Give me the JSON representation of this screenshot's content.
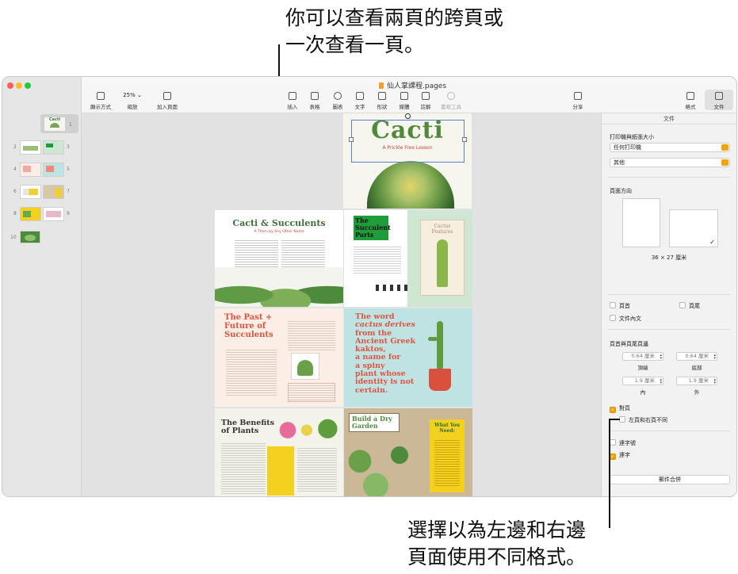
{
  "callouts": {
    "top_line1": "你可以查看兩頁的跨頁或",
    "top_line2": "一次查看一頁。",
    "bottom_line1": "選擇以為左邊和右邊",
    "bottom_line2": "頁面使用不同格式。"
  },
  "window": {
    "title": "仙人掌課程.pages"
  },
  "toolbar": {
    "view": "顯示方式",
    "zoom_value": "25%",
    "zoom": "縮放",
    "add_page": "加入頁面",
    "insert": "插入",
    "table": "表格",
    "chart": "圖表",
    "text": "文字",
    "shape": "形狀",
    "media": "媒體",
    "comment": "註解",
    "collab": "書寫工具",
    "share": "分享",
    "format": "格式",
    "document": "文件"
  },
  "thumbnails": {
    "numbers": [
      "1",
      "2",
      "3",
      "4",
      "5",
      "6",
      "7",
      "8",
      "9",
      "10"
    ],
    "first_title": "Cacti"
  },
  "pages": {
    "p1_title": "Cacti",
    "p1_subtitle": "A Prickle Free Lesson",
    "p2_title": "Cacti & Succulents",
    "p2_subtitle": "A Thorn by Any Other Name",
    "p3_title_l1": "The",
    "p3_title_l2": "Succulent",
    "p3_title_l3": "Parts",
    "p3_side": "Cactus Features",
    "p4_title_l1": "The Past +",
    "p4_title_l2": "Future of",
    "p4_title_l3": "Succulents",
    "p5_quote_l1": "The word",
    "p5_quote_l2": "cactus derives",
    "p5_quote_l3": "from the",
    "p5_quote_l4": "Ancient Greek",
    "p5_quote_l5": "kaktos,",
    "p5_quote_l6": "a name for",
    "p5_quote_l7": "a spiny",
    "p5_quote_l8": "plant whose",
    "p5_quote_l9": "identity is not",
    "p5_quote_l10": "certain.",
    "p6_title_l1": "The Benefits",
    "p6_title_l2": "of Plants",
    "p7_title_l1": "Build a Dry",
    "p7_title_l2": "Garden",
    "p7_side_l1": "What You",
    "p7_side_l2": "Need:"
  },
  "inspector": {
    "tab": "文件",
    "printer_label": "打印機與紙張大小",
    "printer_value": "任何打印機",
    "paper_value": "其他",
    "orientation_label": "頁面方向",
    "page_size": "36 × 27 厘米",
    "header": "頁首",
    "footer": "頁尾",
    "body": "文件內文",
    "margins_label": "頁首與頁尾頁邊",
    "top_value": "0.64 厘米",
    "top_caption": "頂端",
    "bottom_value": "0.64 厘米",
    "bottom_caption": "底部",
    "inside_value": "1.9 厘米",
    "inside_caption": "內",
    "outside_value": "1.9 厘米",
    "outside_caption": "外",
    "facing_pages": "對頁",
    "different_lr": "左頁和右頁不同",
    "hyphenation": "連字號",
    "ligatures": "連字",
    "mail_merge": "郵件合併"
  },
  "colors": {
    "accent": "#f0a500",
    "red_heading": "#e0533f",
    "green_heading": "#2e6b34"
  }
}
